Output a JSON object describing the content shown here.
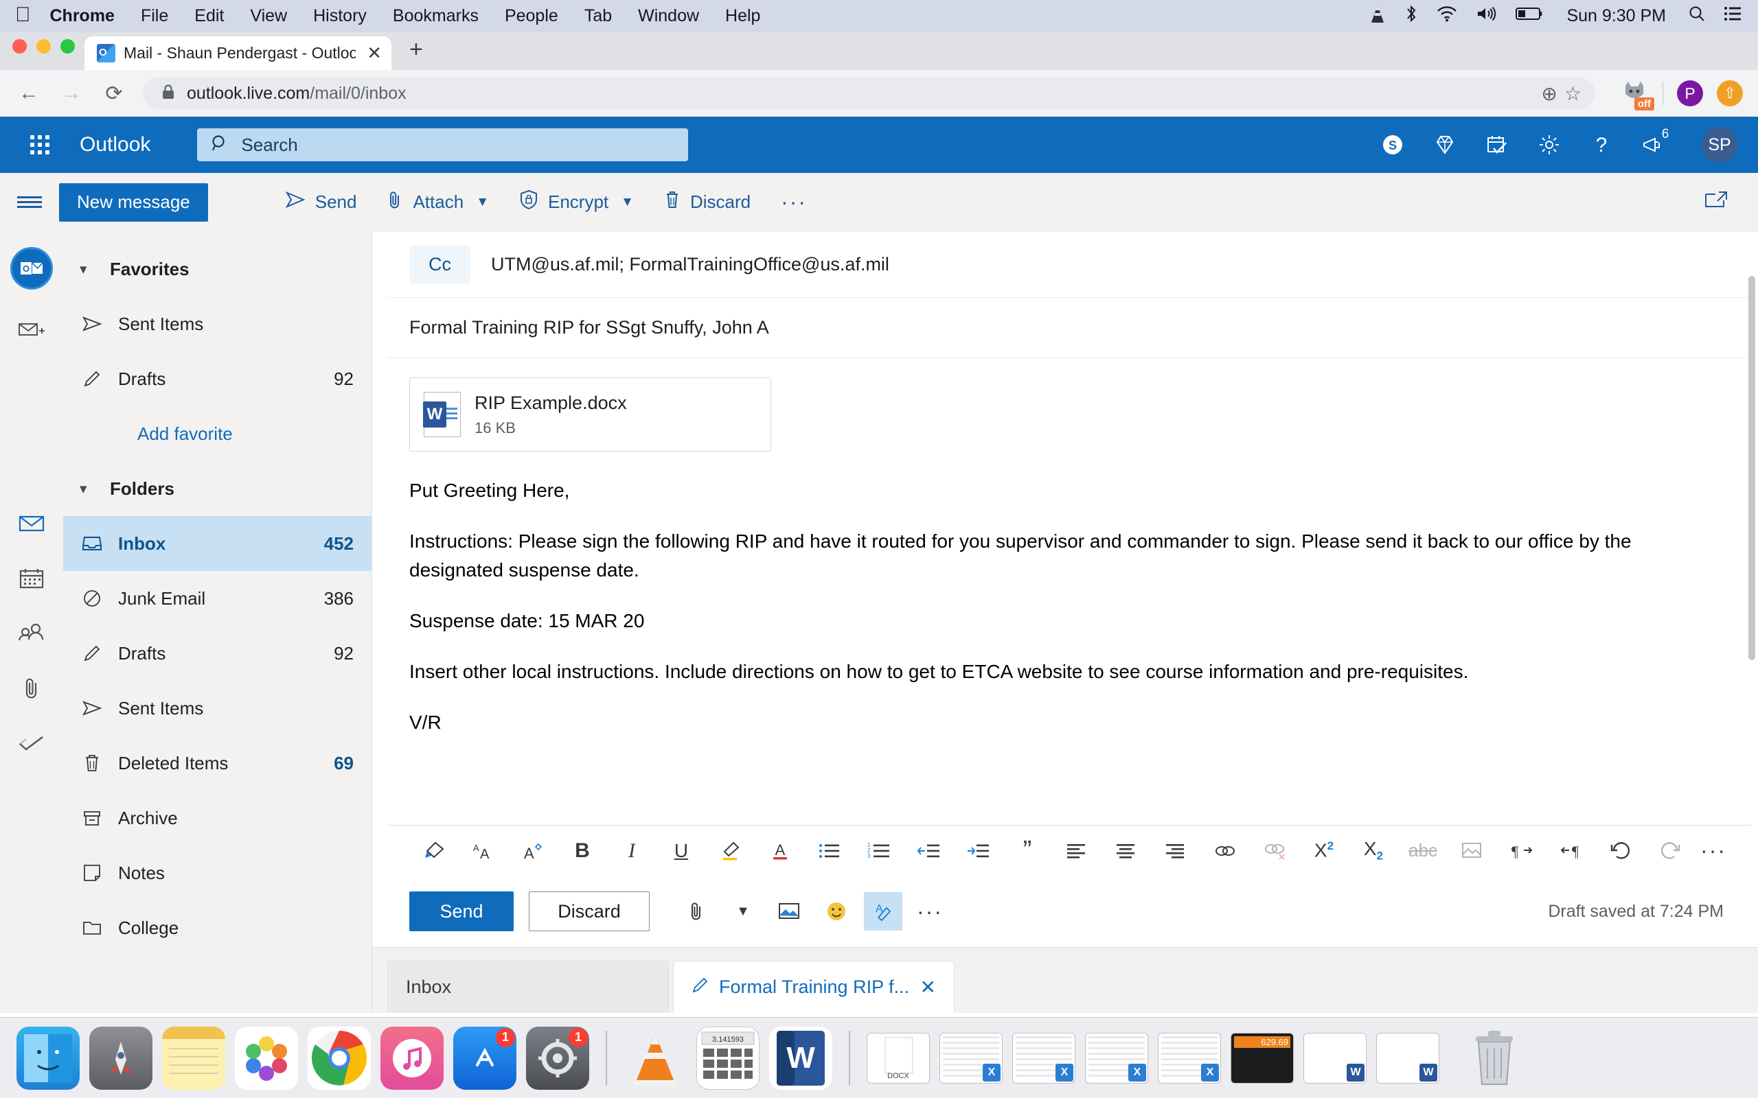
{
  "macos_menubar": {
    "apple_icon": "apple-icon",
    "items": [
      "Chrome",
      "File",
      "Edit",
      "View",
      "History",
      "Bookmarks",
      "People",
      "Tab",
      "Window",
      "Help"
    ],
    "status_icons": [
      "vlc-cone-icon",
      "bluetooth-icon",
      "wifi-icon",
      "volume-icon",
      "battery-icon"
    ],
    "clock": "Sun 9:30 PM",
    "search_icon": "search-icon",
    "control_center_icon": "list-icon"
  },
  "browser": {
    "tab": {
      "title": "Mail - Shaun Pendergast - Outloo",
      "favicon": "outlook-favicon",
      "close_icon": "close-icon"
    },
    "new_tab_icon": "plus-icon",
    "back_icon": "back-arrow-icon",
    "forward_icon": "forward-arrow-icon",
    "reload_icon": "reload-icon",
    "lock_icon": "lock-icon",
    "url_domain": "outlook.live.com",
    "url_path": "/mail/0/inbox",
    "omni_add_icon": "add-to-circle-icon",
    "bookmark_icon": "star-icon",
    "extension_wolf": "wolf-extension-icon",
    "extension_wolf_badge": "off",
    "profile_initial": "P",
    "extension_update_icon": "up-arrow-icon"
  },
  "outlook_header": {
    "waffle_icon": "app-launcher-icon",
    "brand": "Outlook",
    "search": {
      "placeholder": "Search",
      "icon": "search-icon"
    },
    "icons": [
      "skype-icon",
      "diamond-icon",
      "calendar-check-icon",
      "gear-icon",
      "help-icon",
      "megaphone-icon"
    ],
    "notification_count": "6",
    "avatar_initials": "SP"
  },
  "command_bar": {
    "hamburger_icon": "hamburger-icon",
    "new_message_label": "New message",
    "items": [
      {
        "label": "Send",
        "icon": "send-icon",
        "has_chevron": false
      },
      {
        "label": "Attach",
        "icon": "paperclip-icon",
        "has_chevron": true
      },
      {
        "label": "Encrypt",
        "icon": "shield-lock-icon",
        "has_chevron": true
      },
      {
        "label": "Discard",
        "icon": "trash-icon",
        "has_chevron": false
      }
    ],
    "overflow_label": "···",
    "popout_icon": "popout-icon"
  },
  "left_rail": {
    "icons": [
      "outlook-logo-icon",
      "new-mail-icon",
      "mail-icon",
      "calendar-icon",
      "people-icon",
      "attachment-icon",
      "tasks-icon"
    ]
  },
  "folder_pane": {
    "favorites": {
      "label": "Favorites",
      "chevron": "chevron-down-icon",
      "items": [
        {
          "label": "Sent Items",
          "icon": "send-icon",
          "count": ""
        },
        {
          "label": "Drafts",
          "icon": "pencil-icon",
          "count": "92"
        }
      ],
      "add_favorite_label": "Add favorite"
    },
    "folders": {
      "label": "Folders",
      "chevron": "chevron-down-icon",
      "items": [
        {
          "label": "Inbox",
          "icon": "inbox-icon",
          "count": "452",
          "selected": true
        },
        {
          "label": "Junk Email",
          "icon": "block-icon",
          "count": "386",
          "selected": false
        },
        {
          "label": "Drafts",
          "icon": "pencil-icon",
          "count": "92",
          "selected": false
        },
        {
          "label": "Sent Items",
          "icon": "send-icon",
          "count": "",
          "selected": false
        },
        {
          "label": "Deleted Items",
          "icon": "trash-icon",
          "count": "69",
          "count_blue": true,
          "selected": false
        },
        {
          "label": "Archive",
          "icon": "archive-icon",
          "count": "",
          "selected": false
        },
        {
          "label": "Notes",
          "icon": "note-icon",
          "count": "",
          "selected": false
        },
        {
          "label": "College",
          "icon": "folder-icon",
          "count": "",
          "selected": false
        }
      ]
    }
  },
  "compose": {
    "cc_label": "Cc",
    "cc_value": "UTM@us.af.mil; FormalTrainingOffice@us.af.mil",
    "subject": "Formal Training RIP for SSgt Snuffy, John A",
    "attachment": {
      "icon": "word-doc-icon",
      "name": "RIP Example.docx",
      "size": "16 KB"
    },
    "body": [
      "Put Greeting Here,",
      "Instructions:  Please sign the following RIP and have it routed for you supervisor and commander to sign.  Please send it back to our office by the designated suspense date.",
      "Suspense date:  15 MAR 20",
      "Insert other local instructions.  Include directions on how to get to ETCA website to see course information and pre-requisites.",
      "V/R"
    ]
  },
  "format_toolbar": {
    "icons": [
      "format-painter-icon",
      "font-size-icon",
      "font-color-style-icon",
      "bold-icon",
      "italic-icon",
      "underline-icon",
      "highlight-icon",
      "font-color-icon",
      "bulleted-list-icon",
      "numbered-list-icon",
      "decrease-indent-icon",
      "increase-indent-icon",
      "quote-icon",
      "align-left-icon",
      "align-center-icon",
      "align-right-icon",
      "insert-link-icon",
      "remove-link-icon",
      "superscript-icon",
      "subscript-icon",
      "strikethrough-icon",
      "insert-picture-icon",
      "ltr-direction-icon",
      "rtl-direction-icon",
      "undo-icon",
      "redo-icon"
    ],
    "overflow_label": "···"
  },
  "send_bar": {
    "send_label": "Send",
    "discard_label": "Discard",
    "icons": [
      "paperclip-icon",
      "chevron-down-icon",
      "insert-picture-icon",
      "emoji-icon",
      "signature-icon"
    ],
    "overflow_label": "···",
    "draft_status": "Draft saved at 7:24 PM"
  },
  "bottom_tabs": [
    {
      "label": "Inbox",
      "active": false,
      "icon": "",
      "close_icon": ""
    },
    {
      "label": "Formal Training RIP f...",
      "active": true,
      "icon": "pencil-icon",
      "close_icon": "close-icon"
    }
  ],
  "dock": {
    "items": [
      {
        "name": "finder",
        "badge": "",
        "running": true
      },
      {
        "name": "launchpad",
        "badge": "",
        "running": false
      },
      {
        "name": "notes",
        "badge": "",
        "running": false
      },
      {
        "name": "photos",
        "badge": "",
        "running": false
      },
      {
        "name": "chrome",
        "badge": "",
        "running": true
      },
      {
        "name": "itunes",
        "badge": "",
        "running": false
      },
      {
        "name": "app-store",
        "badge": "1",
        "running": false
      },
      {
        "name": "system-preferences",
        "badge": "1",
        "running": false
      },
      {
        "name": "vlc",
        "badge": "",
        "running": true
      },
      {
        "name": "calculator",
        "badge": "",
        "running": false
      },
      {
        "name": "word",
        "badge": "",
        "running": true
      }
    ],
    "minimized_windows": [
      "docx-window",
      "excel-window-1",
      "excel-window-2",
      "excel-window-3",
      "excel-window-4",
      "calculator-window",
      "word-window-1",
      "word-window-2"
    ],
    "calculator_display": "629.69",
    "spreadsheet_value": "3,141592",
    "trash": "trash-icon"
  },
  "colors": {
    "outlook_blue": "#0f6cbd",
    "selected_folder": "#c7e0f4",
    "menubar": "#d3d9e8",
    "chrome_toolbar": "#f1f3f4",
    "pane_bg": "#f3f2f1"
  }
}
